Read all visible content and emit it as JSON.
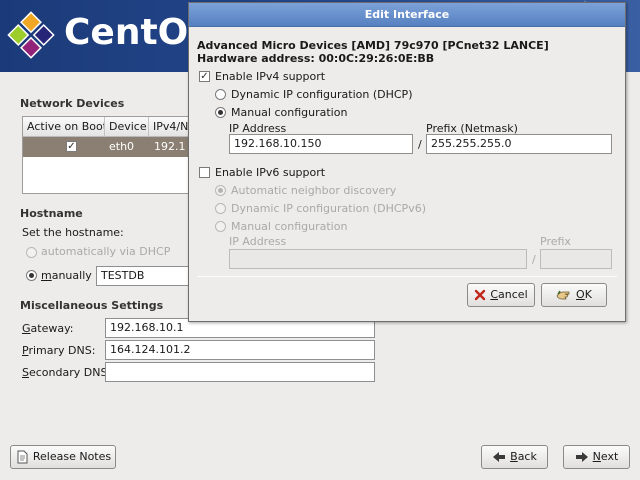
{
  "banner": {
    "brand": "CentOS"
  },
  "network_devices": {
    "title": "Network Devices",
    "columns": [
      "Active on Boot",
      "Device",
      "IPv4/N"
    ],
    "rows": [
      {
        "active": true,
        "device": "eth0",
        "ipv4": "192.1"
      }
    ]
  },
  "hostname": {
    "title": "Hostname",
    "set_label": "Set the hostname:",
    "auto_label": "automatically via DHCP",
    "manual_label_pre": "",
    "manual_label_u": "m",
    "manual_label_post": "anually",
    "manual_value": "TESTDB",
    "mode": "manually"
  },
  "misc": {
    "title": "Miscellaneous Settings",
    "gateway_label_u": "G",
    "gateway_label_post": "ateway:",
    "gateway_value": "192.168.10.1",
    "primary_label_u": "P",
    "primary_label_post": "rimary DNS:",
    "primary_value": "164.124.101.2",
    "secondary_label_u": "S",
    "secondary_label_post": "econdary DNS:",
    "secondary_value": ""
  },
  "footer": {
    "release_notes": "Release Notes",
    "back_u": "B",
    "back_post": "ack",
    "next_u": "N",
    "next_post": "ext"
  },
  "dialog": {
    "title": "Edit Interface",
    "device_line": "Advanced Micro Devices [AMD] 79c970 [PCnet32 LANCE]",
    "hw_line": "Hardware address: 00:0C:29:26:0E:BB",
    "ipv4": {
      "enable_label": "Enable IPv4 support",
      "enabled": true,
      "dhcp_label": "Dynamic IP configuration (DHCP)",
      "manual_label": "Manual configuration",
      "mode": "manual",
      "ip_label": "IP Address",
      "ip_value": "192.168.10.150",
      "slash": "/",
      "prefix_label": "Prefix (Netmask)",
      "prefix_value": "255.255.255.0"
    },
    "ipv6": {
      "enable_label": "Enable IPv6 support",
      "enabled": false,
      "auto_label": "Automatic neighbor discovery",
      "dhcp_label": "Dynamic IP configuration (DHCPv6)",
      "manual_label": "Manual configuration",
      "ip_label": "IP Address",
      "ip_value": "",
      "slash": "/",
      "prefix_label": "Prefix",
      "prefix_value": ""
    },
    "cancel_u": "C",
    "cancel_post": "ancel",
    "ok_u": "O",
    "ok_post": "K"
  },
  "colors": {
    "banner": "#25498f",
    "title_bar": "#6a91cd",
    "selected_row": "#8a7f72"
  }
}
